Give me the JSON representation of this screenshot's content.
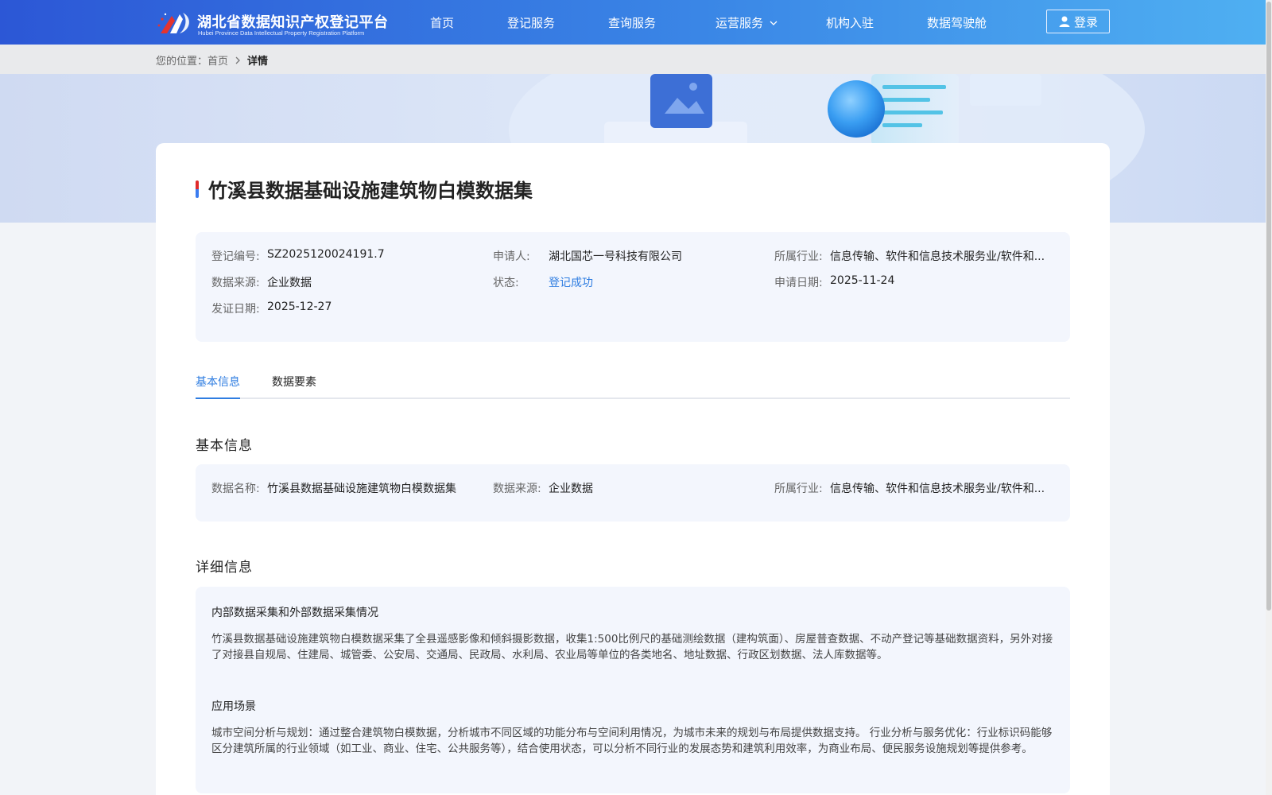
{
  "header": {
    "logo_cn": "湖北省数据知识产权登记平台",
    "logo_en": "Hubei Province Data Intellectual Property Registration Platform",
    "nav": [
      {
        "label": "首页"
      },
      {
        "label": "登记服务"
      },
      {
        "label": "查询服务"
      },
      {
        "label": "运营服务"
      },
      {
        "label": "机构入驻"
      },
      {
        "label": "数据驾驶舱"
      }
    ],
    "login_label": "登录"
  },
  "breadcrumb": {
    "prefix": "您的位置：",
    "home": "首页",
    "current": "详情"
  },
  "detail": {
    "title": "竹溪县数据基础设施建筑物白模数据集",
    "summary": {
      "reg_no_label": "登记编号:",
      "reg_no": "SZ2025120024191.7",
      "applicant_label": "申请人:",
      "applicant": "湖北国芯一号科技有限公司",
      "industry_label": "所属行业:",
      "industry": "信息传输、软件和信息技术服务业/软件和...",
      "source_label": "数据来源:",
      "source": "企业数据",
      "status_label": "状态:",
      "status": "登记成功",
      "apply_date_label": "申请日期:",
      "apply_date": "2025-11-24",
      "issue_date_label": "发证日期:",
      "issue_date": "2025-12-27"
    },
    "tabs": [
      {
        "label": "基本信息"
      },
      {
        "label": "数据要素"
      }
    ],
    "basic": {
      "section_title": "基本信息",
      "name_label": "数据名称:",
      "name": "竹溪县数据基础设施建筑物白模数据集",
      "source_label": "数据来源:",
      "source": "企业数据",
      "industry_label": "所属行业:",
      "industry": "信息传输、软件和信息技术服务业/软件和..."
    },
    "detailed": {
      "section_title": "详细信息",
      "collection_title": "内部数据采集和外部数据采集情况",
      "collection_text": "竹溪县数据基础设施建筑物白模数据采集了全县遥感影像和倾斜摄影数据，收集1:500比例尺的基础测绘数据（建构筑面）、房屋普查数据、不动产登记等基础数据资料，另外对接了对接县自规局、住建局、城管委、公安局、交通局、民政局、水利局、农业局等单位的各类地名、地址数据、行政区划数据、法人库数据等。",
      "scenario_title": "应用场景",
      "scenario_text": "城市空间分析与规划：通过整合建筑物白模数据，分析城市不同区域的功能分布与空间利用情况，为城市未来的规划与布局提供数据支持。 行业分析与服务优化：行业标识码能够区分建筑所属的行业领域（如工业、商业、住宅、公共服务等），结合使用状态，可以分析不同行业的发展态势和建筑利用效率，为商业布局、便民服务设施规划等提供参考。"
    }
  }
}
